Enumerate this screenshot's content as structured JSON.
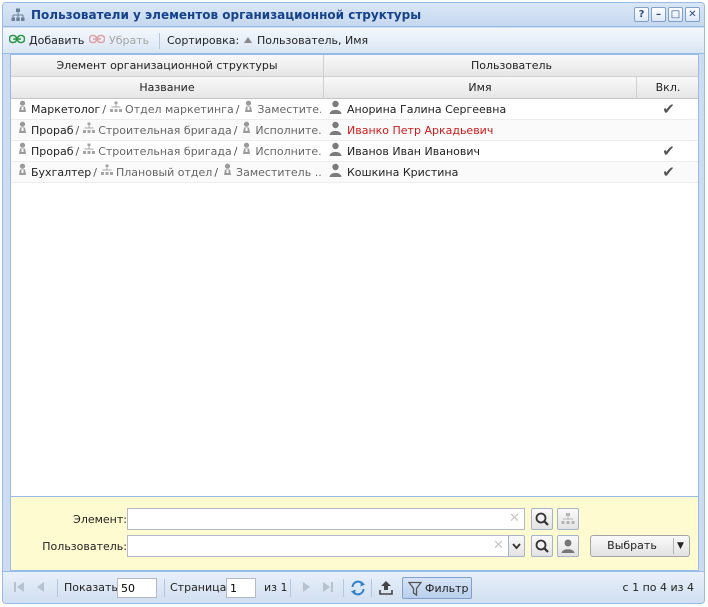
{
  "window": {
    "title": "Пользователи у элементов организационной структуры",
    "tools": [
      "?",
      "–",
      "□",
      "✕"
    ]
  },
  "toolbar": {
    "add_label": "Добавить",
    "remove_label": "Убрать",
    "sort_label": "Сортировка:",
    "sort_value": "Пользователь, Имя"
  },
  "grid": {
    "group_headers": [
      "Элемент организационной структуры",
      "Пользователь"
    ],
    "columns": [
      "Название",
      "Имя",
      "Вкл."
    ],
    "rows": [
      {
        "segments": [
          "Маркетолог",
          "Отдел маркетинга",
          "Заместите..."
        ],
        "user": "Анорина Галина Сергеевна",
        "enabled": "✔"
      },
      {
        "segments": [
          "Прораб",
          "Строительная бригада",
          "Исполните..."
        ],
        "user": "Иванко Петр Аркадьевич",
        "enabled": ""
      },
      {
        "segments": [
          "Прораб",
          "Строительная бригада",
          "Исполните..."
        ],
        "user": "Иванов Иван Иванович",
        "enabled": "✔"
      },
      {
        "segments": [
          "Бухгалтер",
          "Плановый отдел",
          "Заместитель ..."
        ],
        "user": "Кошкина Кристина",
        "enabled": "✔"
      }
    ]
  },
  "filter": {
    "element_label": "Элемент:",
    "element_value": "",
    "user_label": "Пользователь:",
    "user_value": "",
    "select_label": "Выбрать"
  },
  "pager": {
    "show_label": "Показать",
    "page_size": "50",
    "page_label": "Страница",
    "page_value": "1",
    "of_label": "из 1",
    "filter_label": "Фильтр",
    "summary": "с 1 по 4 из 4"
  },
  "colors": {
    "accent_text": "#15428b",
    "highlight_user": "#d01a1a",
    "filter_bg": "#fffbd1"
  }
}
